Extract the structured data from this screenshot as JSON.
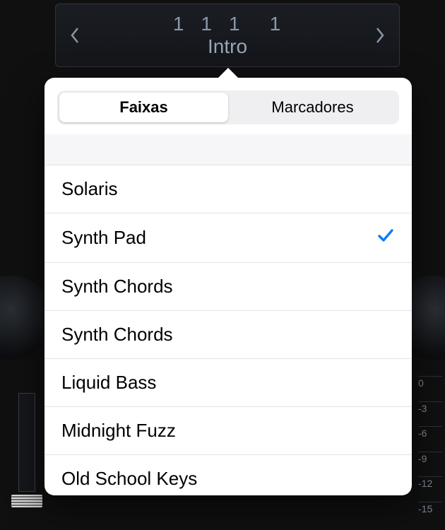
{
  "topbar": {
    "position": [
      "1",
      "1",
      "1",
      "1"
    ],
    "label": "Intro"
  },
  "segmented": {
    "active": "Faixas",
    "inactive": "Marcadores"
  },
  "tracks": [
    {
      "name": "Solaris",
      "selected": false
    },
    {
      "name": "Synth Pad",
      "selected": true
    },
    {
      "name": "Synth Chords",
      "selected": false
    },
    {
      "name": "Synth Chords",
      "selected": false
    },
    {
      "name": "Liquid Bass",
      "selected": false
    },
    {
      "name": "Midnight Fuzz",
      "selected": false
    },
    {
      "name": "Old School Keys",
      "selected": false
    }
  ],
  "ruler": [
    "0",
    "-3",
    "-6",
    "-9",
    "-12",
    "-15"
  ],
  "colors": {
    "accent": "#0a7bff"
  }
}
